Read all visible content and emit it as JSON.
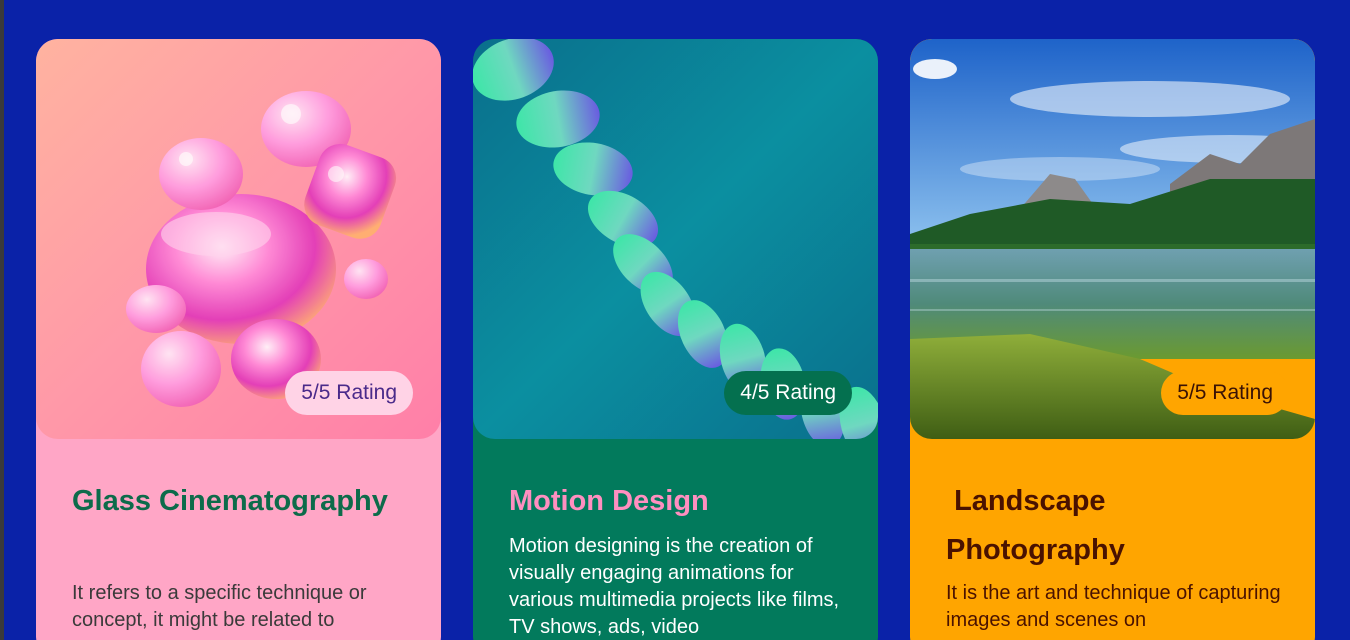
{
  "cards": [
    {
      "rating": "5/5 Rating",
      "title": "Glass Cinematography",
      "description": "It refers to a specific technique or concept, it might be related to",
      "image_icon": "glass-blob-image",
      "colors": {
        "background": "#ffa6c6",
        "title": "#0d6b4a",
        "badge_bg": "#ffd3e6"
      }
    },
    {
      "rating": "4/5 Rating",
      "title": "Motion Design",
      "description": "Motion designing is the creation of visually engaging animations for various multimedia projects like films, TV shows, ads, video",
      "image_icon": "spiral-ribbon-image",
      "colors": {
        "background": "#027a5c",
        "title": "#ff8fc0",
        "badge_bg": "#04704f"
      }
    },
    {
      "rating": "5/5 Rating",
      "title": " Landscape Photography",
      "description": "It is  the art and technique of capturing images and scenes on",
      "image_icon": "mountain-lake-image",
      "colors": {
        "background": "#ffa500",
        "title": "#4a1200",
        "badge_bg": "#ffa500"
      }
    }
  ],
  "page": {
    "background": "#0a22a8"
  }
}
